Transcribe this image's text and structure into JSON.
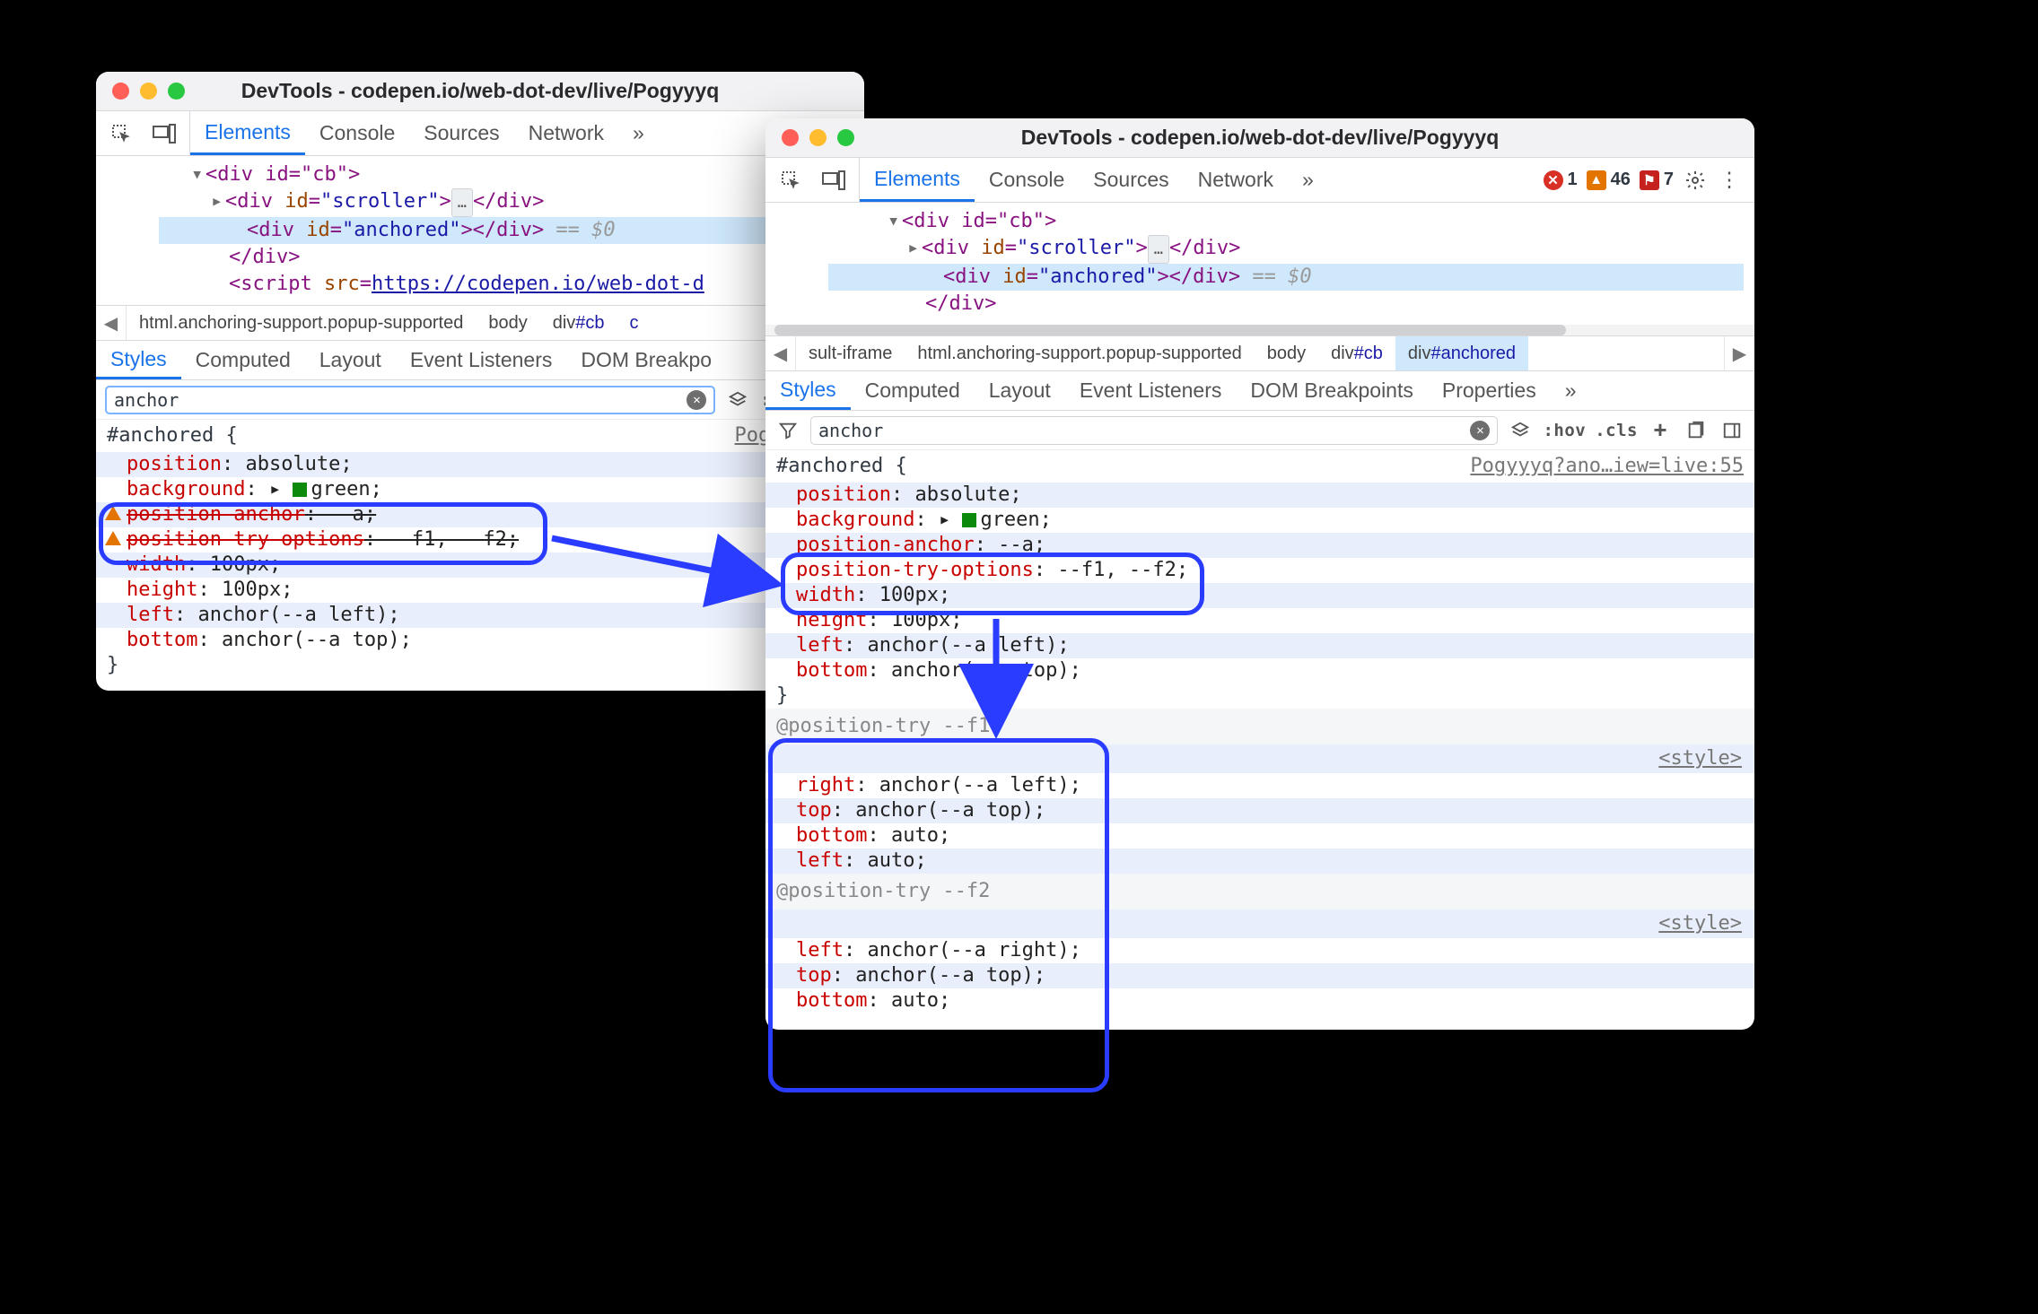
{
  "shared": {
    "window_title": "DevTools - codepen.io/web-dot-dev/live/Pogyyyq",
    "tabs": [
      "Elements",
      "Console",
      "Sources",
      "Network"
    ],
    "subtabs": [
      "Styles",
      "Computed",
      "Layout",
      "Event Listeners",
      "DOM Breakpoints",
      "Properties"
    ],
    "filter_value": "anchor",
    "filter_hov": ":hov",
    "filter_cls": ".cls"
  },
  "w1": {
    "dom": {
      "cb_open": "<div id=\"cb\">",
      "scroller": "<div id=\"scroller\">…</div>",
      "anchored": "<div id=\"anchored\"></div>",
      "eq0": "== $0",
      "close_div": "</div>",
      "script_open": "<script src=\"",
      "script_href": "https://codepen.io/web-dot-d"
    },
    "crumbs": {
      "html": "html.anchoring-support.popup-supported",
      "body": "body",
      "divcb": "div#cb"
    },
    "rule": {
      "selector": "#anchored {",
      "source": "Pogyyyq?an",
      "d1_p": "position",
      "d1_v": ": absolute;",
      "d2_p": "background",
      "d2_v": ": ▸ ",
      "d2_v2": "green;",
      "d3_p": "position-anchor",
      "d3_v": ": --a;",
      "d4_p": "position-try-options",
      "d4_v": ": --f1, --f2;",
      "d5_p": "width",
      "d5_v": ": 100px;",
      "d6_p": "height",
      "d6_v": ": 100px;",
      "d7_p": "left",
      "d7_v": ": anchor(--a left);",
      "d8_p": "bottom",
      "d8_v": ": anchor(--a top);",
      "close": "}"
    }
  },
  "w2": {
    "counts": {
      "errors": "1",
      "warnings": "46",
      "flags": "7"
    },
    "dom": {
      "cb_open": "<div id=\"cb\">",
      "scroller": "<div id=\"scroller\">…</div>",
      "anchored": "<div id=\"anchored\"></div>",
      "eq0": "== $0",
      "close_div": "</div>"
    },
    "crumbs": {
      "iframe": "sult-iframe",
      "html": "html.anchoring-support.popup-supported",
      "body": "body",
      "divcb": "div#cb",
      "divanchored": "div#anchored"
    },
    "rule": {
      "selector": "#anchored {",
      "source": "Pogyyyq?ano…iew=live:55",
      "d1_p": "position",
      "d1_v": ": absolute;",
      "d2_p": "background",
      "d2_v": ": ▸ ",
      "d2_v2": "green;",
      "d3_p": "position-anchor",
      "d3_v": ": --a;",
      "d4_p": "position-try-options",
      "d4_v": ": --f1, --f2;",
      "d5_p": "width",
      "d5_v": ": 100px;",
      "d6_p": "height",
      "d6_v": ": 100px;",
      "d7_p": "left",
      "d7_v": ": anchor(--a left);",
      "d8_p": "bottom",
      "d8_v": ": anchor(--a top);",
      "close": "}"
    },
    "ptry1": {
      "head": "@position-try --f1",
      "d1_p": "right",
      "d1_v": ": anchor(--a left);",
      "d2_p": "top",
      "d2_v": ": anchor(--a top);",
      "d3_p": "bottom",
      "d3_v": ": auto;",
      "d4_p": "left",
      "d4_v": ": auto;"
    },
    "ptry2": {
      "head": "@position-try --f2",
      "d1_p": "left",
      "d1_v": ": anchor(--a right);",
      "d2_p": "top",
      "d2_v": ": anchor(--a top);",
      "d3_p": "bottom",
      "d3_v": ": auto;"
    },
    "stylelbl": "<style>"
  }
}
